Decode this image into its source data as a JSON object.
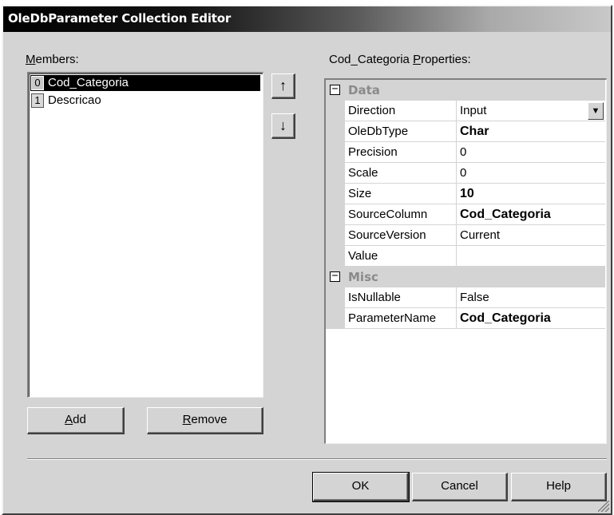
{
  "window": {
    "title": "OleDbParameter Collection Editor"
  },
  "members": {
    "label_accel": "M",
    "label_rest": "embers:",
    "items": [
      {
        "index": "0",
        "name": "Cod_Categoria",
        "selected": true
      },
      {
        "index": "1",
        "name": "Descricao",
        "selected": false
      }
    ],
    "move_up_icon": "↑",
    "move_down_icon": "↓"
  },
  "buttons": {
    "add_accel": "A",
    "add_rest": "dd",
    "remove_accel": "R",
    "remove_rest": "emove",
    "ok": "OK",
    "cancel": "Cancel",
    "help": "Help"
  },
  "properties": {
    "label_pre": "Cod_Categoria ",
    "label_accel": "P",
    "label_rest": "roperties:",
    "categories": [
      {
        "name": "Data",
        "toggle": "−",
        "rows": [
          {
            "name": "Direction",
            "value": "Input",
            "bold": false,
            "dropdown": true
          },
          {
            "name": "OleDbType",
            "value": "Char",
            "bold": true
          },
          {
            "name": "Precision",
            "value": "0",
            "bold": false
          },
          {
            "name": "Scale",
            "value": "0",
            "bold": false
          },
          {
            "name": "Size",
            "value": "10",
            "bold": true
          },
          {
            "name": "SourceColumn",
            "value": "Cod_Categoria",
            "bold": true
          },
          {
            "name": "SourceVersion",
            "value": "Current",
            "bold": false
          },
          {
            "name": "Value",
            "value": "",
            "bold": false
          }
        ]
      },
      {
        "name": "Misc",
        "toggle": "−",
        "rows": [
          {
            "name": "IsNullable",
            "value": "False",
            "bold": false
          },
          {
            "name": "ParameterName",
            "value": "Cod_Categoria",
            "bold": true
          }
        ]
      }
    ]
  }
}
